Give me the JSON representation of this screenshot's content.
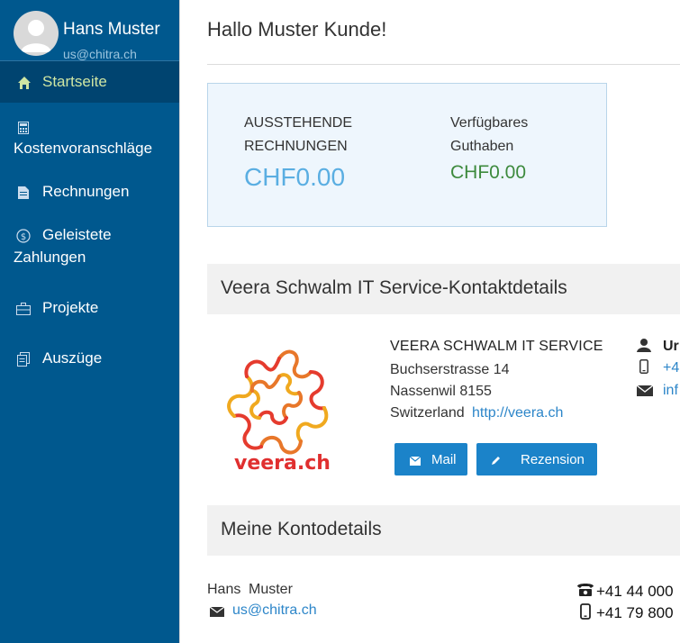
{
  "user": {
    "name": "Hans Muster",
    "email": "us@chitra.ch"
  },
  "sidebar": {
    "items": [
      {
        "label": "Startseite",
        "icon": "home-icon",
        "active": true
      },
      {
        "label": "Kostenvoranschläge",
        "icon": "calculator-icon"
      },
      {
        "label": "Rechnungen",
        "icon": "document-icon"
      },
      {
        "label": "Geleistete",
        "label2": "Zahlungen",
        "icon": "dollar-icon"
      },
      {
        "label": "Projekte",
        "icon": "briefcase-icon"
      },
      {
        "label": "Auszüge",
        "icon": "statement-icon"
      }
    ]
  },
  "main": {
    "greeting": "Hallo Muster Kunde!",
    "balance": {
      "outstanding_label_1": "AUSSTEHENDE",
      "outstanding_label_2": "RECHNUNGEN",
      "outstanding_value": "CHF0.00",
      "credit_label_1": "Verfügbares",
      "credit_label_2": "Guthaben",
      "credit_value": "CHF0.00"
    },
    "contact_section": {
      "title": "Veera Schwalm IT Service-Kontaktdetails",
      "logo_text": "veera.ch",
      "company": "VEERA SCHWALM IT SERVICE",
      "street": "Buchserstrasse 14",
      "city": "Nassenwil 8155",
      "country": "Switzerland",
      "website": "http://veera.ch",
      "mail_button": "Mail",
      "review_button": "Rezension",
      "contact_person": "Ur",
      "phone": "+4",
      "email": "inf"
    },
    "account_section": {
      "title": "Meine Kontodetails",
      "first_name": "Hans",
      "last_name": "Muster",
      "email": "us@chitra.ch",
      "phone": "+41 44 000",
      "mobile": "+41 79 800"
    }
  },
  "colors": {
    "sidebar_bg": "#00588e",
    "sidebar_active": "#004470",
    "active_text": "#cfe6a3",
    "accent": "#1b83c9",
    "balance_blue": "#5aaee2",
    "balance_green": "#3d8a3d"
  }
}
